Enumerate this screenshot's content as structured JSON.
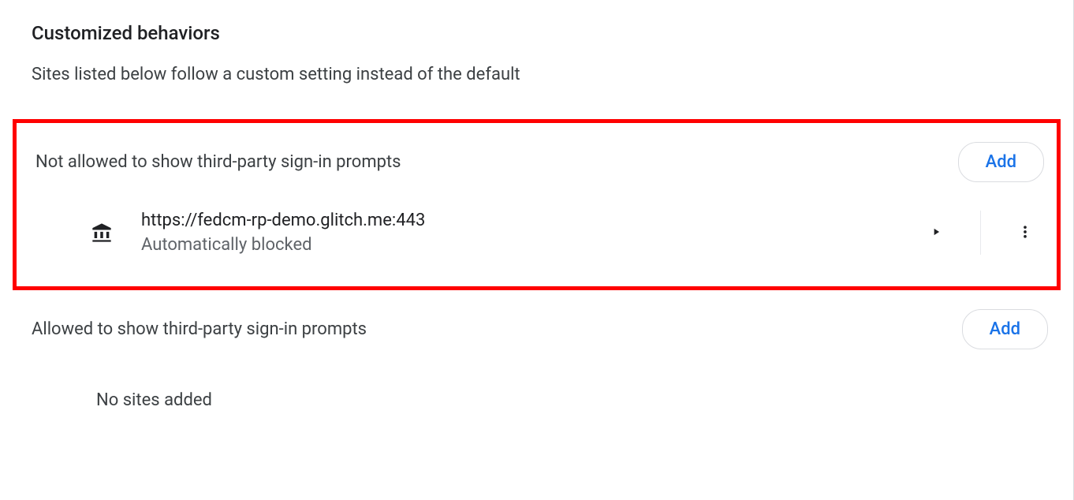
{
  "heading": "Customized behaviors",
  "description": "Sites listed below follow a custom setting instead of the default",
  "not_allowed": {
    "title": "Not allowed to show third-party sign-in prompts",
    "add_label": "Add",
    "sites": [
      {
        "url": "https://fedcm-rp-demo.glitch.me:443",
        "status": "Automatically blocked"
      }
    ]
  },
  "allowed": {
    "title": "Allowed to show third-party sign-in prompts",
    "add_label": "Add",
    "empty_text": "No sites added"
  }
}
